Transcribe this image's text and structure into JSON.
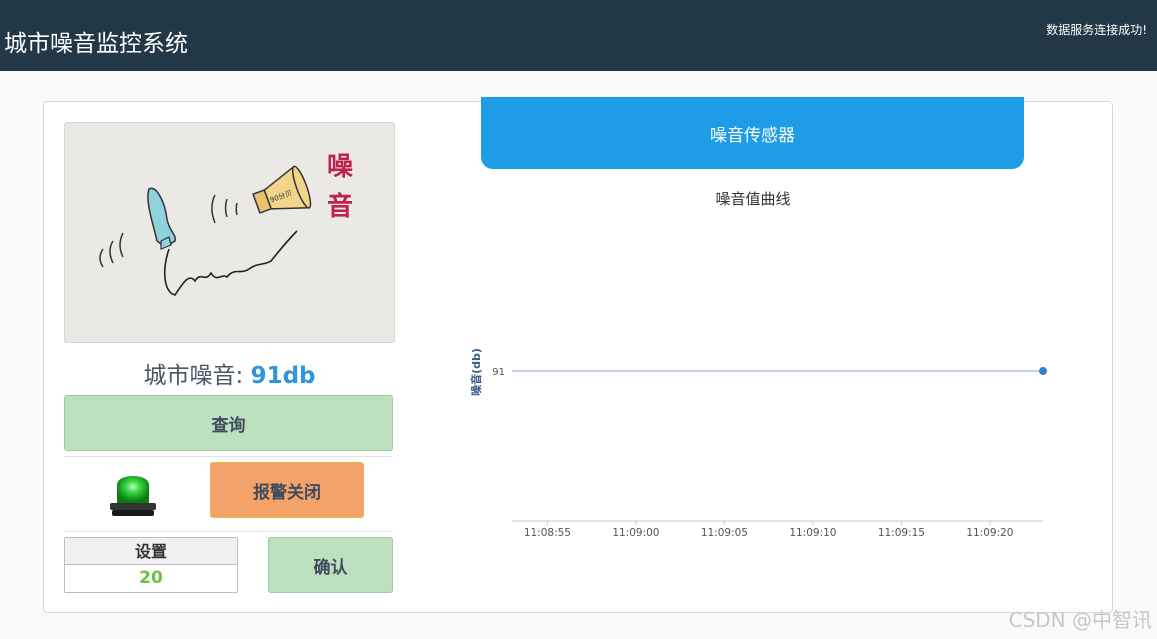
{
  "header": {
    "app_title": "城市噪音监控系统",
    "status_message": "数据服务连接成功!",
    "background_color": "#233847"
  },
  "illustration": {
    "title_glyph_1": "噪",
    "title_glyph_2": "音",
    "speaker_label": "90分贝"
  },
  "noise_readout": {
    "label": "城市噪音:",
    "value": "91db"
  },
  "buttons": {
    "query_label": "查询",
    "alarm_off_label": "报警关闭",
    "confirm_label": "确认"
  },
  "alarm_light": {
    "state": "green",
    "icon": "siren-icon"
  },
  "setting": {
    "label": "设置",
    "value": "20"
  },
  "sensor_panel": {
    "header": "噪音传感器",
    "accent_color": "#1e9ce6"
  },
  "chart_data": {
    "type": "line",
    "title": "噪音值曲线",
    "ylabel": "噪音(db)",
    "xlabel": "",
    "x_ticks": [
      "11:08:55",
      "11:09:00",
      "11:09:05",
      "11:09:10",
      "11:09:15",
      "11:09:20"
    ],
    "y_ticks": [
      91
    ],
    "x_range": [
      "11:08:53",
      "11:09:23"
    ],
    "series": [
      {
        "x": [
          "11:08:53",
          "11:09:23"
        ],
        "values": [
          91,
          91
        ],
        "color": "#3a7fcf"
      }
    ],
    "point": {
      "x": "11:09:23",
      "value": 91
    },
    "grid": false
  },
  "watermark": "CSDN @中智讯"
}
